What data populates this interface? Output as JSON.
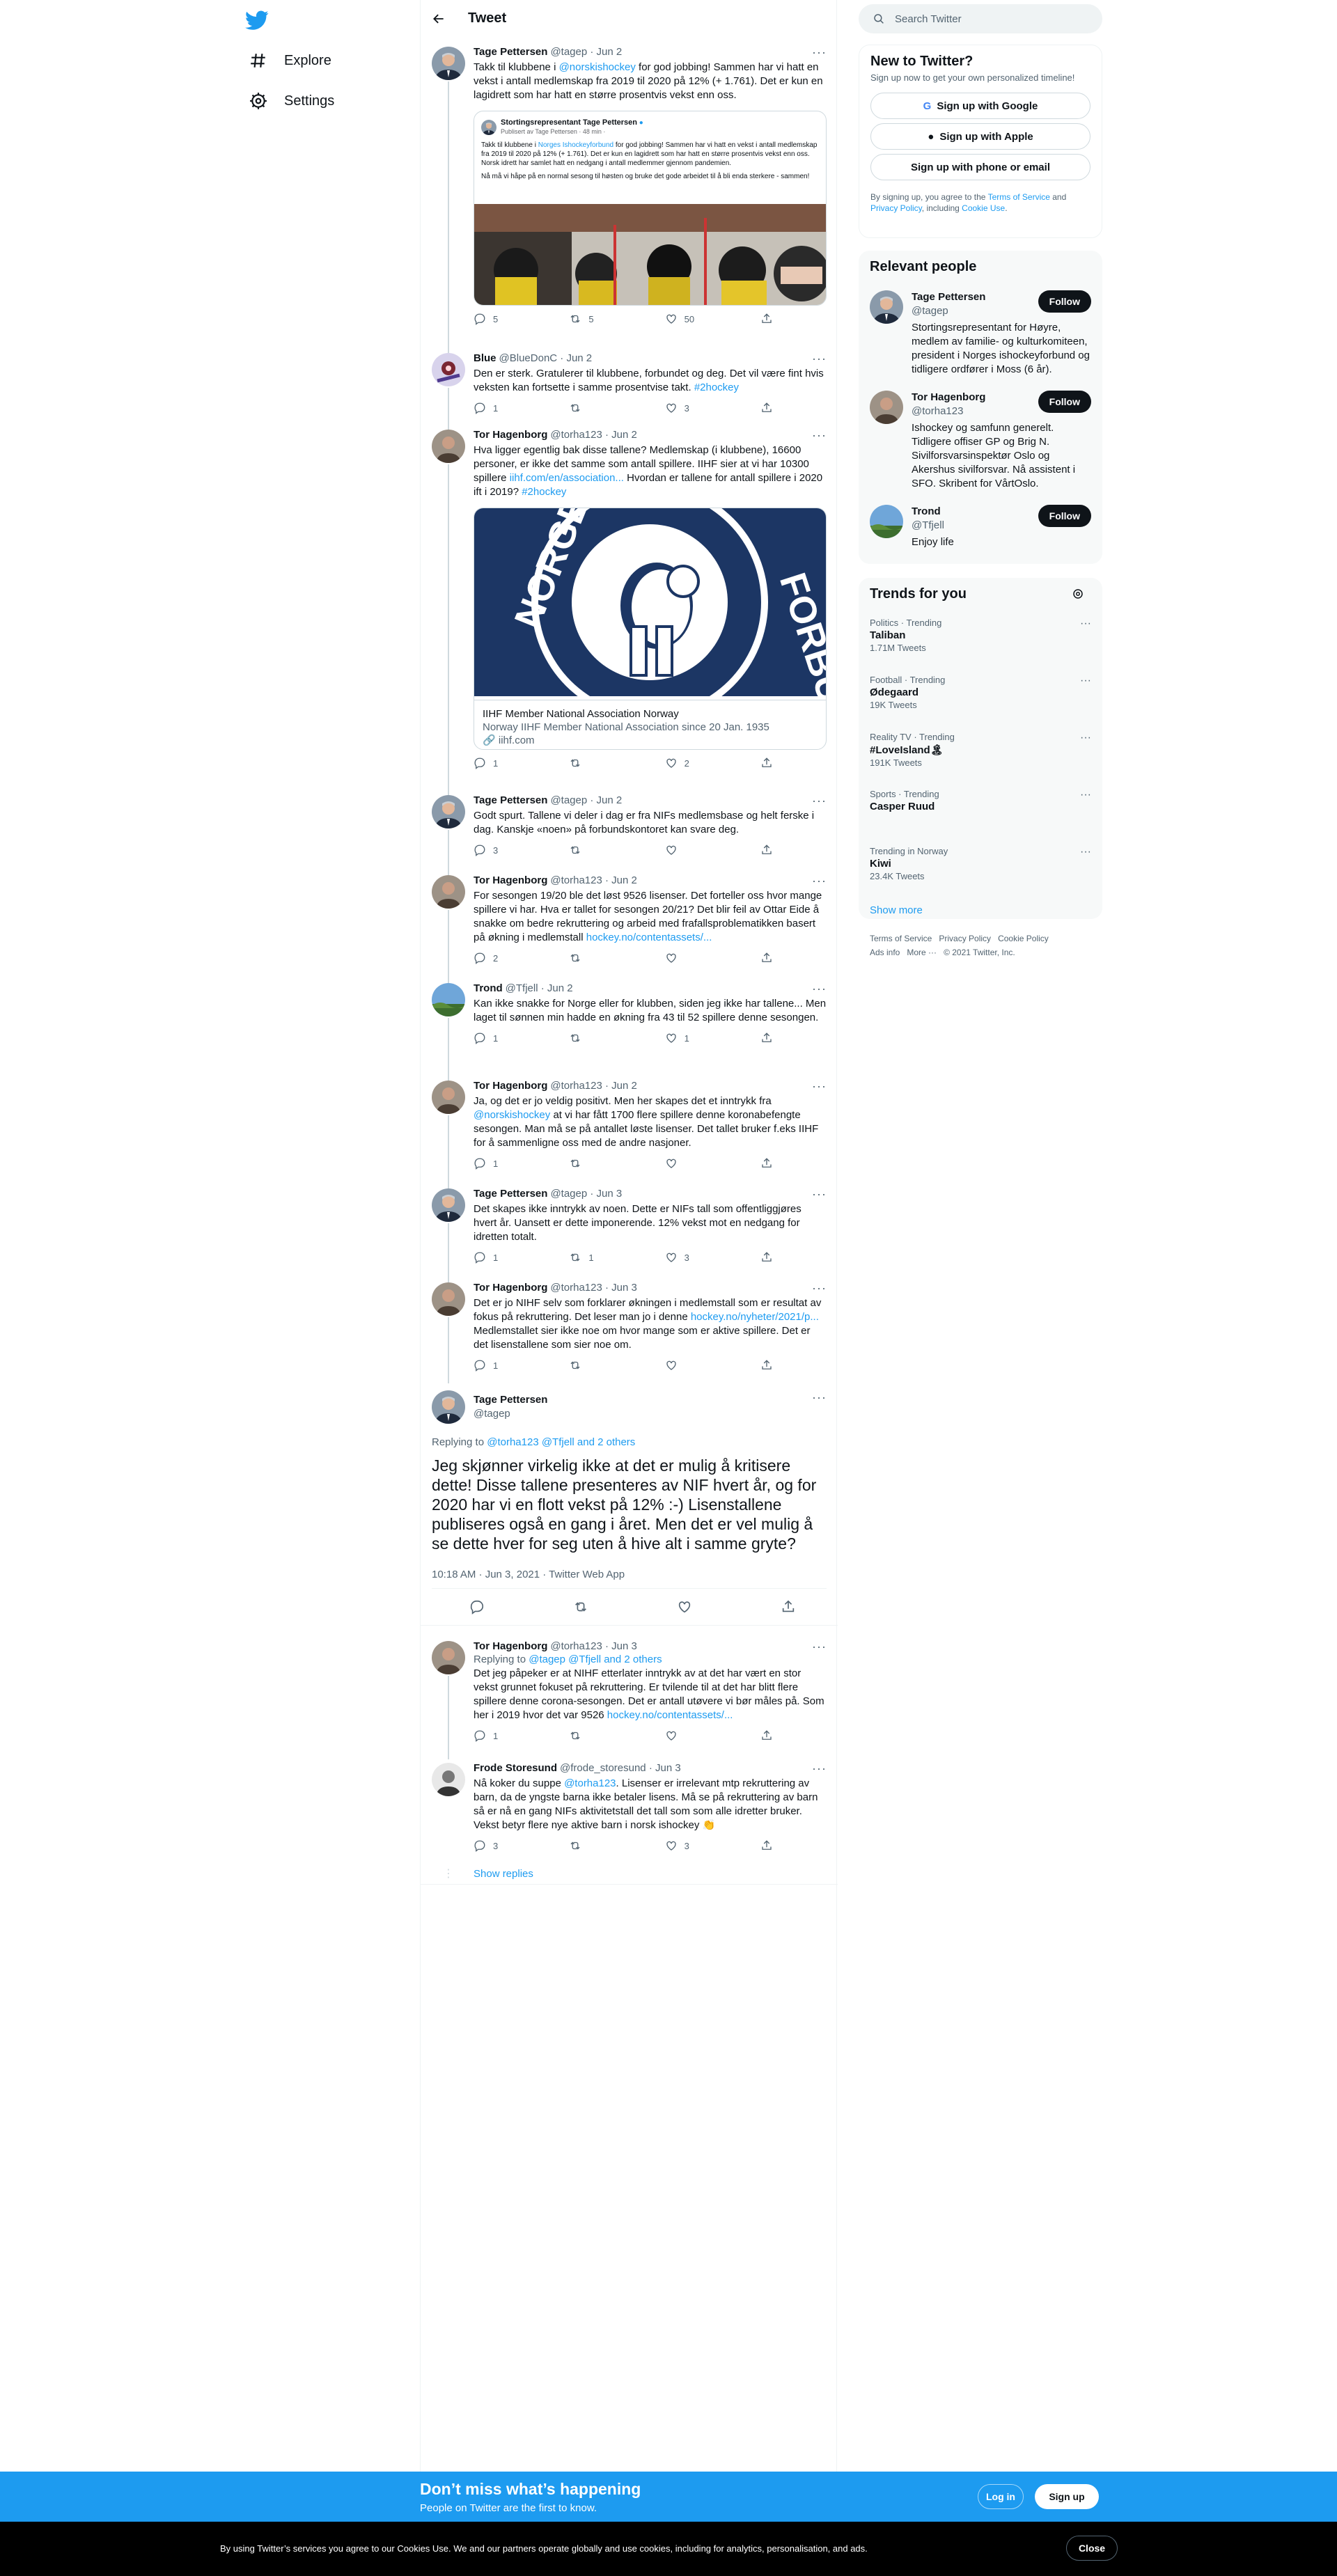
{
  "nav": {
    "explore": "Explore",
    "settings": "Settings"
  },
  "header": {
    "title": "Tweet"
  },
  "search": {
    "placeholder": "Search Twitter"
  },
  "tweets": [
    {
      "name": "Tage Pettersen",
      "handle": "@tagep · Jun 2",
      "text1": "Takk til klubbene i ",
      "mention": "@norskishockey",
      "text2": " for god jobbing! Sammen har vi hatt en vekst i antall medlemskap fra 2019 til 2020 på 12% (+ 1.761). Det er kun en lagidrett som har hatt en større prosentvis vekst enn oss.",
      "reply": "5",
      "rt": "5",
      "like": "50"
    },
    {
      "name": "Blue",
      "handle": "@BlueDonC · Jun 2",
      "text": "Den er sterk. Gratulerer til klubbene, forbundet og deg. Det vil være fint hvis veksten kan fortsette i samme prosentvise takt. ",
      "tag": "#2hockey",
      "reply": "1",
      "rt": "",
      "like": "3"
    },
    {
      "name": "Tor Hagenborg",
      "handle": "@torha123 · Jun 2",
      "text": "Hva ligger egentlig bak disse tallene? Medlemskap (i klubbene), 16600 personer, er ikke det samme som antall spillere. IIHF sier at vi har 10300 spillere ",
      "link": "iihf.com/en/association...",
      "text2": " Hvordan er tallene for antall spillere i 2020 ift i 2019? ",
      "tag": "#2hockey",
      "reply": "1",
      "rt": "",
      "like": "2"
    },
    {
      "name": "Tage Pettersen",
      "handle": "@tagep · Jun 2",
      "text": "Godt spurt. Tallene vi deler i dag er fra NIFs medlemsbase og helt ferske i dag. Kanskje «noen» på forbundskontoret kan svare deg.",
      "reply": "3",
      "rt": "",
      "like": ""
    },
    {
      "name": "Tor Hagenborg",
      "handle": "@torha123 · Jun 2",
      "text": "For sesongen 19/20 ble det løst 9526 lisenser. Det forteller oss hvor mange spillere vi har. Hva er tallet for sesongen 20/21? Det blir feil av Ottar Eide å snakke om bedre rekruttering og arbeid med frafallsproblematikken basert på økning i medlemstall ",
      "link": "hockey.no/contentassets/...",
      "reply": "2",
      "rt": "",
      "like": ""
    },
    {
      "name": "Trond",
      "handle": "@Tfjell · Jun 2",
      "text": "Kan ikke snakke for Norge eller for klubben, siden jeg ikke har tallene... Men laget til sønnen min hadde en økning fra 43 til 52 spillere denne sesongen.",
      "reply": "1",
      "rt": "",
      "like": "1"
    },
    {
      "name": "Tor Hagenborg",
      "handle": "@torha123 · Jun 2",
      "text1": "Ja, og det er jo veldig positivt. Men her skapes det et inntrykk fra ",
      "mention": "@norskishockey",
      "text2": " at vi har fått 1700 flere spillere denne koronabefengte sesongen. Man må se på antallet løste lisenser. Det tallet bruker f.eks IIHF for å sammenligne oss med de andre nasjoner.",
      "reply": "1",
      "rt": "",
      "like": ""
    },
    {
      "name": "Tage Pettersen",
      "handle": "@tagep · Jun 3",
      "text": "Det skapes ikke inntrykk av noen. Dette er NIFs tall som offentliggjøres hvert år. Uansett er dette imponerende. 12% vekst mot en nedgang for idretten totalt.",
      "reply": "1",
      "rt": "1",
      "like": "3"
    },
    {
      "name": "Tor Hagenborg",
      "handle": "@torha123 · Jun 3",
      "text": "Det er jo NIHF selv som forklarer økningen i medlemstall som er resultat av fokus på rekruttering. Det leser man jo i denne ",
      "link": "hockey.no/nyheter/2021/p...",
      "text2": " Medlemstallet sier ikke noe om hvor mange som er aktive spillere. Det er det lisenstallene som sier noe om.",
      "reply": "1",
      "rt": "",
      "like": ""
    }
  ],
  "quote": {
    "name": "Stortingsrepresentant Tage Pettersen",
    "sub": "Publisert av Tage Pettersen · 48 min ·",
    "t1": "Takk til klubbene i ",
    "link": "Norges Ishockeyforbund",
    "t2": " for god jobbing! Sammen har vi hatt en vekst i antall medlemskap fra 2019 til 2020 på 12% (+ 1.761). Det er kun en lagidrett som har hatt en større prosentvis vekst enn oss. Norsk idrett har samlet hatt en nedgang i antall medlemmer gjennom pandemien.",
    "t3": "Nå må vi håpe på en normal sesong til høsten og bruke det gode arbeidet til å bli enda sterkere - sammen!"
  },
  "linkcard": {
    "title": "IIHF Member National Association Norway",
    "desc": "Norway IIHF Member National Association since 20 Jan. 1935",
    "domain": "iihf.com",
    "logo_top": "NORGES",
    "logo_right": "FORBUND"
  },
  "focus": {
    "name": "Tage Pettersen",
    "handle": "@tagep",
    "replying": "Replying to ",
    "replying_to": "@torha123 @Tfjell and 2 others",
    "text": "Jeg skjønner virkelig ikke at det er mulig å kritisere dette! Disse tallene presenteres av NIF hvert år, og for 2020 har vi en flott vekst på 12% :-) Lisenstallene publiseres også en gang i året. Men det er vel mulig å se dette hver for seg uten å hive alt i samme gryte?",
    "meta": "10:18 AM · Jun 3, 2021 · Twitter Web App"
  },
  "replies": [
    {
      "name": "Tor Hagenborg",
      "handle": "@torha123 · Jun 3",
      "replying": "Replying to ",
      "replying_to": "@tagep @Tfjell and 2 others",
      "text": "Det jeg påpeker er at NIHF etterlater inntrykk av at det har vært en stor vekst grunnet fokuset på rekruttering. Er  tvilende til at det har blitt flere spillere denne corona-sesongen. Det er antall utøvere vi bør måles på. Som her i 2019 hvor det var 9526 ",
      "link": "hockey.no/contentassets/...",
      "reply": "1",
      "rt": "",
      "like": ""
    },
    {
      "name": "Frode Storesund",
      "handle": "@frode_storesund · Jun 3",
      "text1": "Nå koker du suppe ",
      "mention": "@torha123",
      "text2": ". Lisenser er irrelevant mtp rekruttering av barn, da de yngste barna ikke betaler lisens. Må se på rekruttering av barn så er nå en gang NIFs aktivitetstall det tall som som alle idretter bruker. Vekst betyr flere nye aktive barn i norsk ishockey 👏",
      "reply": "3",
      "rt": "",
      "like": "3"
    }
  ],
  "show_replies": "Show replies",
  "new_to": {
    "title": "New to Twitter?",
    "sub": "Sign up now to get your own personalized timeline!",
    "google": "Sign up with Google",
    "apple": "Sign up with Apple",
    "phone": "Sign up with phone or email",
    "legal1": "By signing up, you agree to the ",
    "tos": "Terms of Service",
    "legal2": " and ",
    "pp": "Privacy Policy",
    "legal3": ", including ",
    "cu": "Cookie Use",
    "legal4": "."
  },
  "relevant": {
    "title": "Relevant people",
    "follow": "Follow",
    "people": [
      {
        "name": "Tage Pettersen",
        "handle": "@tagep",
        "bio": "Stortingsrepresentant for Høyre, medlem av familie- og kulturkomiteen, president i Norges ishockeyforbund og tidligere ordfører i Moss (6 år)."
      },
      {
        "name": "Tor Hagenborg",
        "handle": "@torha123",
        "bio": "Ishockey og samfunn generelt. Tidligere offiser GP og Brig N. Sivilforsvarsinspektør Oslo og Akershus sivilforsvar. Nå assistent i SFO. Skribent for VårtOslo."
      },
      {
        "name": "Trond",
        "handle": "@Tfjell",
        "bio": "Enjoy life"
      }
    ]
  },
  "trends": {
    "title": "Trends for you",
    "items": [
      {
        "cat": "Politics · Trending",
        "name": "Taliban",
        "count": "1.71M Tweets"
      },
      {
        "cat": "Football · Trending",
        "name": "Ødegaard",
        "count": "19K Tweets"
      },
      {
        "cat": "Reality TV · Trending",
        "name": "#LoveIsland🏝",
        "count": "191K Tweets"
      },
      {
        "cat": "Sports · Trending",
        "name": "Casper Ruud",
        "count": ""
      },
      {
        "cat": "Trending in Norway",
        "name": "Kiwi",
        "count": "23.4K Tweets"
      }
    ],
    "show_more": "Show more"
  },
  "footer": {
    "tos": "Terms of Service",
    "pp": "Privacy Policy",
    "cp": "Cookie Policy",
    "ads": "Ads info",
    "more": "More ···",
    "copy": "© 2021 Twitter, Inc."
  },
  "banner": {
    "title": "Don’t miss what’s happening",
    "sub": "People on Twitter are the first to know.",
    "login": "Log in",
    "signup": "Sign up"
  },
  "cookie": {
    "text": "By using Twitter’s services you agree to our Cookies Use. We and our partners operate globally and use cookies, including for analytics, personalisation, and ads.",
    "close": "Close"
  },
  "colors": {
    "accent": "#1d9bf0",
    "text": "#0f1419",
    "muted": "#536471"
  }
}
